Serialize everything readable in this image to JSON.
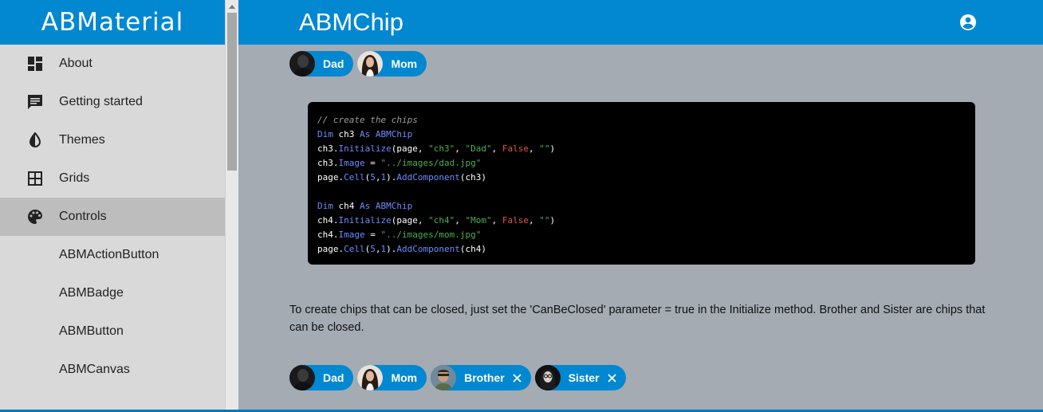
{
  "brand": "ABMaterial",
  "header": {
    "title": "ABMChip",
    "account_icon": "account-circle-icon"
  },
  "sidebar": {
    "items": [
      {
        "label": "About",
        "icon": "dashboard-icon"
      },
      {
        "label": "Getting started",
        "icon": "chat-icon"
      },
      {
        "label": "Themes",
        "icon": "contrast-icon"
      },
      {
        "label": "Grids",
        "icon": "grid-icon"
      },
      {
        "label": "Controls",
        "icon": "palette-icon",
        "active": true
      }
    ],
    "subitems": [
      "ABMActionButton",
      "ABMBadge",
      "ABMButton",
      "ABMCanvas"
    ]
  },
  "chips_top": [
    {
      "label": "Dad"
    },
    {
      "label": "Mom"
    }
  ],
  "code": {
    "comment": "// create the chips",
    "l1_kw": "Dim",
    "l1_var": " ch3 ",
    "l1_as": "As",
    "l1_type": " ABMChip",
    "l2_a": "ch3.",
    "l2_fn": "Initialize",
    "l2_b": "(page, ",
    "l2_s1": "\"ch3\"",
    "l2_c": ", ",
    "l2_s2": "\"Dad\"",
    "l2_d": ", ",
    "l2_f": "False",
    "l2_e": ", ",
    "l2_s3": "\"\"",
    "l2_g": ")",
    "l3_a": "ch3.",
    "l3_prop": "Image",
    "l3_b": " = ",
    "l3_s": "\"../images/dad.jpg\"",
    "l4_a": "page.",
    "l4_fn": "Cell",
    "l4_b": "(",
    "l4_n1": "5",
    "l4_c": ",",
    "l4_n2": "1",
    "l4_d": ").",
    "l4_fn2": "AddComponent",
    "l4_e": "(ch3)",
    "l6_kw": "Dim",
    "l6_var": " ch4 ",
    "l6_as": "As",
    "l6_type": " ABMChip",
    "l7_a": "ch4.",
    "l7_fn": "Initialize",
    "l7_b": "(page, ",
    "l7_s1": "\"ch4\"",
    "l7_c": ", ",
    "l7_s2": "\"Mom\"",
    "l7_d": ", ",
    "l7_f": "False",
    "l7_e": ", ",
    "l7_s3": "\"\"",
    "l7_g": ")",
    "l8_a": "ch4.",
    "l8_prop": "Image",
    "l8_b": " = ",
    "l8_s": "\"../images/mom.jpg\"",
    "l9_a": "page.",
    "l9_fn": "Cell",
    "l9_b": "(",
    "l9_n1": "5",
    "l9_c": ",",
    "l9_n2": "1",
    "l9_d": ").",
    "l9_fn2": "AddComponent",
    "l9_e": "(ch4)"
  },
  "description": "To create chips that can be closed, just set the 'CanBeClosed' parameter = true in the Initialize method. Brother and Sister are chips that can be closed.",
  "chips_bottom": [
    {
      "label": "Dad",
      "closable": false
    },
    {
      "label": "Mom",
      "closable": false
    },
    {
      "label": "Brother",
      "closable": true
    },
    {
      "label": "Sister",
      "closable": true
    }
  ],
  "colors": {
    "primary": "#0288d1",
    "content_bg": "#a4abb3",
    "sidebar_bg": "#d9d9d9",
    "active_bg": "#bdbdbd"
  }
}
